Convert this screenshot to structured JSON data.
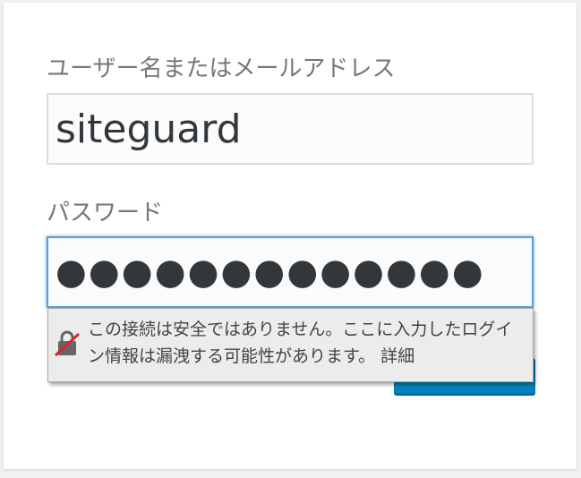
{
  "login_form": {
    "username_label": "ユーザー名またはメールアドレス",
    "username_value": "siteguard",
    "password_label": "パスワード",
    "password_masked": "●●●●●●●●●●●●●"
  },
  "security_warning": {
    "icon": "insecure-lock-icon",
    "message": "この接続は安全ではありません。ここに入力したログイン情報は漏洩する可能性があります。",
    "link_label": "詳細"
  },
  "colors": {
    "label": "#72777c",
    "input_focus_border": "#5b9dd9",
    "button": "#0085ba",
    "warning_slash": "#d9232e"
  }
}
